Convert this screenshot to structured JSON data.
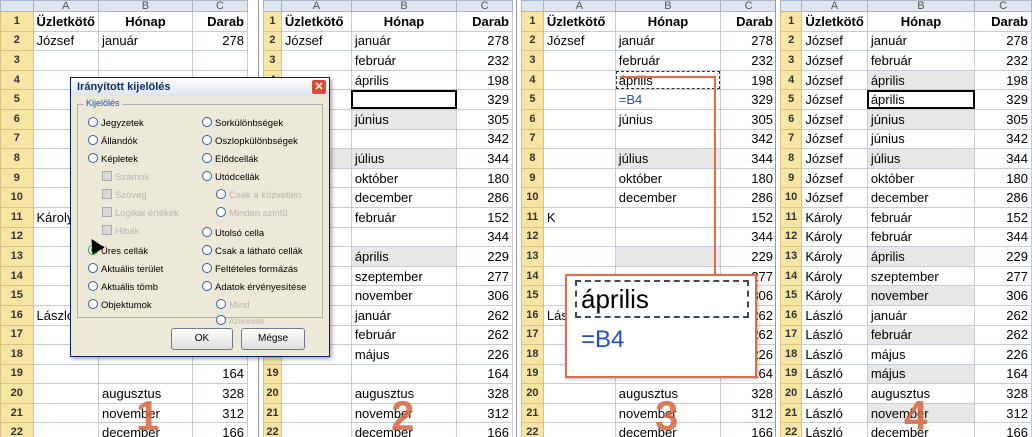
{
  "columns": [
    "A",
    "B",
    "C"
  ],
  "headers": [
    "Üzletkötő",
    "Hónap",
    "Darab"
  ],
  "row_numbers": [
    "1",
    "2",
    "3",
    "4",
    "5",
    "6",
    "7",
    "8",
    "9",
    "10",
    "11",
    "12",
    "13",
    "14",
    "15",
    "16",
    "17",
    "18",
    "19",
    "20",
    "21",
    "22"
  ],
  "panels": [
    {
      "id": "1",
      "big_number": "1",
      "rows": [
        [
          "József",
          "január",
          "278"
        ],
        [
          "",
          "",
          ""
        ],
        [
          "",
          "",
          ""
        ],
        [
          "",
          "",
          ""
        ],
        [
          "",
          "",
          ""
        ],
        [
          "",
          "",
          ""
        ],
        [
          "",
          "",
          ""
        ],
        [
          "",
          "",
          ""
        ],
        [
          "",
          "",
          ""
        ],
        [
          "Károly",
          "",
          ""
        ],
        [
          "",
          "",
          ""
        ],
        [
          "",
          "",
          ""
        ],
        [
          "",
          "",
          ""
        ],
        [
          "",
          "",
          ""
        ],
        [
          "László",
          "",
          ""
        ],
        [
          "",
          "",
          ""
        ],
        [
          "",
          "",
          ""
        ],
        [
          "",
          "",
          "164"
        ],
        [
          "",
          "augusztus",
          "328"
        ],
        [
          "",
          "november",
          "312"
        ],
        [
          "",
          "december",
          "166"
        ]
      ]
    },
    {
      "id": "2",
      "big_number": "2",
      "rows": [
        [
          "József",
          "január",
          "278"
        ],
        [
          "",
          "február",
          "232"
        ],
        [
          "",
          "április",
          "198"
        ],
        [
          "",
          "",
          "329"
        ],
        [
          "",
          "június",
          "305"
        ],
        [
          "",
          "",
          "342"
        ],
        [
          "",
          "július",
          "344"
        ],
        [
          "",
          "október",
          "180"
        ],
        [
          "",
          "december",
          "286"
        ],
        [
          "oly",
          "február",
          "152"
        ],
        [
          "",
          "",
          "344"
        ],
        [
          "",
          "április",
          "229"
        ],
        [
          "",
          "szeptember",
          "277"
        ],
        [
          "",
          "november",
          "306"
        ],
        [
          "zló",
          "január",
          "262"
        ],
        [
          "",
          "február",
          "262"
        ],
        [
          "",
          "május",
          "226"
        ],
        [
          "",
          "",
          "164"
        ],
        [
          "",
          "augusztus",
          "328"
        ],
        [
          "",
          "november",
          "312"
        ],
        [
          "",
          "december",
          "166"
        ]
      ]
    },
    {
      "id": "3",
      "big_number": "3",
      "rows": [
        [
          "József",
          "január",
          "278"
        ],
        [
          "",
          "február",
          "232"
        ],
        [
          "",
          "április",
          "198"
        ],
        [
          "",
          "=B4",
          "329"
        ],
        [
          "",
          "június",
          "305"
        ],
        [
          "",
          "",
          "342"
        ],
        [
          "",
          "július",
          "344"
        ],
        [
          "",
          "október",
          "180"
        ],
        [
          "",
          "december",
          "286"
        ],
        [
          "K",
          "",
          "152"
        ],
        [
          "",
          "",
          "344"
        ],
        [
          "",
          "",
          "229"
        ],
        [
          "",
          "",
          "277"
        ],
        [
          "",
          "november",
          "306"
        ],
        [
          "László",
          "január",
          "262"
        ],
        [
          "",
          "február",
          "262"
        ],
        [
          "",
          "május",
          "226"
        ],
        [
          "",
          "",
          "164"
        ],
        [
          "",
          "augusztus",
          "328"
        ],
        [
          "",
          "november",
          "312"
        ],
        [
          "",
          "december",
          "166"
        ]
      ]
    },
    {
      "id": "4",
      "big_number": "4",
      "rows": [
        [
          "József",
          "január",
          "278"
        ],
        [
          "József",
          "február",
          "232"
        ],
        [
          "József",
          "április",
          "198"
        ],
        [
          "József",
          "április",
          "329"
        ],
        [
          "József",
          "június",
          "305"
        ],
        [
          "József",
          "június",
          "342"
        ],
        [
          "József",
          "július",
          "344"
        ],
        [
          "József",
          "október",
          "180"
        ],
        [
          "József",
          "december",
          "286"
        ],
        [
          "Károly",
          "február",
          "152"
        ],
        [
          "Károly",
          "február",
          "344"
        ],
        [
          "Károly",
          "április",
          "229"
        ],
        [
          "Károly",
          "szeptember",
          "277"
        ],
        [
          "Károly",
          "november",
          "306"
        ],
        [
          "László",
          "január",
          "262"
        ],
        [
          "László",
          "február",
          "262"
        ],
        [
          "László",
          "május",
          "226"
        ],
        [
          "László",
          "május",
          "164"
        ],
        [
          "László",
          "augusztus",
          "328"
        ],
        [
          "László",
          "november",
          "312"
        ],
        [
          "László",
          "december",
          "166"
        ]
      ]
    }
  ],
  "dialog": {
    "title": "Irányított kijelölés",
    "group_label": "Kijelölés",
    "left_options": [
      "Jegyzetek",
      "Állandók",
      "Képletek",
      "Számok",
      "Szöveg",
      "Logikai értékek",
      "Hibák",
      "Üres cellák",
      "Aktuális terület",
      "Aktuális tömb",
      "Objektumok"
    ],
    "right_options": [
      "Sorkülönbségek",
      "Oszlopkülönbségek",
      "Elődcellák",
      "Utódcellák",
      "Csak a közvetlen",
      "Minden szintű",
      "Utolsó cella",
      "Csak a látható cellák",
      "Feltételes formázás",
      "Adatok érvényesítése",
      "Mind",
      "Azonosak"
    ],
    "ok_label": "OK",
    "cancel_label": "Mégse",
    "selected_option": "Üres cellák"
  },
  "zoom": {
    "value": "április",
    "formula": "=B4"
  },
  "colors": {
    "row_header": "#f7e5a3",
    "col_header": "#dfe6ef",
    "accent": "#e06c4a",
    "formula": "#1e52c6"
  }
}
